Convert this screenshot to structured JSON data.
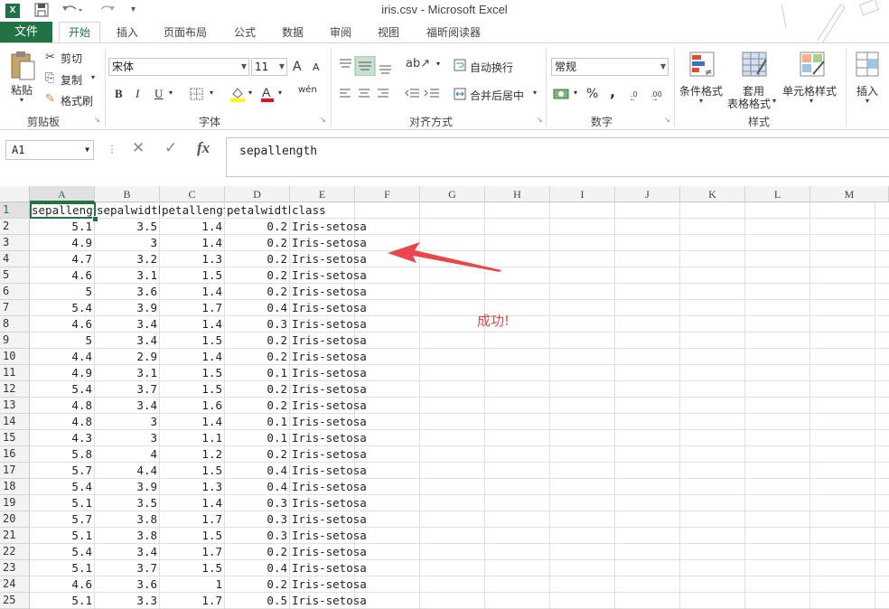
{
  "window": {
    "title": "iris.csv - Microsoft Excel",
    "app_icon": "X"
  },
  "quick_access": {
    "save": "save-icon",
    "undo": "undo-icon",
    "redo": "redo-icon"
  },
  "tabs": [
    {
      "label": "文件"
    },
    {
      "label": "开始"
    },
    {
      "label": "插入"
    },
    {
      "label": "页面布局"
    },
    {
      "label": "公式"
    },
    {
      "label": "数据"
    },
    {
      "label": "审阅"
    },
    {
      "label": "视图"
    },
    {
      "label": "福昕阅读器"
    }
  ],
  "ribbon": {
    "clipboard": {
      "paste": "粘贴",
      "cut": "剪切",
      "copy": "复制",
      "format_painter": "格式刷",
      "label": "剪贴板"
    },
    "font": {
      "name": "宋体",
      "size": "11",
      "grow": "A",
      "shrink": "A",
      "bold": "B",
      "italic": "I",
      "underline": "U",
      "phonetic": "wén",
      "label": "字体"
    },
    "alignment": {
      "wrap": "自动换行",
      "merge": "合并后居中",
      "label": "对齐方式"
    },
    "number": {
      "format": "常规",
      "percent": "%",
      "comma": ",",
      "label": "数字"
    },
    "styles": {
      "conditional": "条件格式",
      "table_line1": "套用",
      "table_line2": "表格格式",
      "cell_styles": "单元格样式",
      "label": "样式"
    },
    "cells": {
      "insert": "插入"
    }
  },
  "formula_bar": {
    "name_box": "A1",
    "cancel": "✕",
    "enter": "✓",
    "fx": "fx",
    "content": "sepallength"
  },
  "columns": [
    "A",
    "B",
    "C",
    "D",
    "E",
    "F",
    "G",
    "H",
    "I",
    "J",
    "K",
    "L",
    "M"
  ],
  "rows": [
    [
      "sepallength",
      "sepalwidth",
      "petallength",
      "petalwidth",
      "class"
    ],
    [
      "5.1",
      "3.5",
      "1.4",
      "0.2",
      "Iris-setosa"
    ],
    [
      "4.9",
      "3",
      "1.4",
      "0.2",
      "Iris-setosa"
    ],
    [
      "4.7",
      "3.2",
      "1.3",
      "0.2",
      "Iris-setosa"
    ],
    [
      "4.6",
      "3.1",
      "1.5",
      "0.2",
      "Iris-setosa"
    ],
    [
      "5",
      "3.6",
      "1.4",
      "0.2",
      "Iris-setosa"
    ],
    [
      "5.4",
      "3.9",
      "1.7",
      "0.4",
      "Iris-setosa"
    ],
    [
      "4.6",
      "3.4",
      "1.4",
      "0.3",
      "Iris-setosa"
    ],
    [
      "5",
      "3.4",
      "1.5",
      "0.2",
      "Iris-setosa"
    ],
    [
      "4.4",
      "2.9",
      "1.4",
      "0.2",
      "Iris-setosa"
    ],
    [
      "4.9",
      "3.1",
      "1.5",
      "0.1",
      "Iris-setosa"
    ],
    [
      "5.4",
      "3.7",
      "1.5",
      "0.2",
      "Iris-setosa"
    ],
    [
      "4.8",
      "3.4",
      "1.6",
      "0.2",
      "Iris-setosa"
    ],
    [
      "4.8",
      "3",
      "1.4",
      "0.1",
      "Iris-setosa"
    ],
    [
      "4.3",
      "3",
      "1.1",
      "0.1",
      "Iris-setosa"
    ],
    [
      "5.8",
      "4",
      "1.2",
      "0.2",
      "Iris-setosa"
    ],
    [
      "5.7",
      "4.4",
      "1.5",
      "0.4",
      "Iris-setosa"
    ],
    [
      "5.4",
      "3.9",
      "1.3",
      "0.4",
      "Iris-setosa"
    ],
    [
      "5.1",
      "3.5",
      "1.4",
      "0.3",
      "Iris-setosa"
    ],
    [
      "5.7",
      "3.8",
      "1.7",
      "0.3",
      "Iris-setosa"
    ],
    [
      "5.1",
      "3.8",
      "1.5",
      "0.3",
      "Iris-setosa"
    ],
    [
      "5.4",
      "3.4",
      "1.7",
      "0.2",
      "Iris-setosa"
    ],
    [
      "5.1",
      "3.7",
      "1.5",
      "0.4",
      "Iris-setosa"
    ],
    [
      "4.6",
      "3.6",
      "1",
      "0.2",
      "Iris-setosa"
    ],
    [
      "5.1",
      "3.3",
      "1.7",
      "0.5",
      "Iris-setosa"
    ]
  ],
  "selected_cell": "A1",
  "annotation": {
    "text": "成功!",
    "color": "#e8474b"
  },
  "colors": {
    "accent": "#217346",
    "arrow": "#e8474b"
  }
}
